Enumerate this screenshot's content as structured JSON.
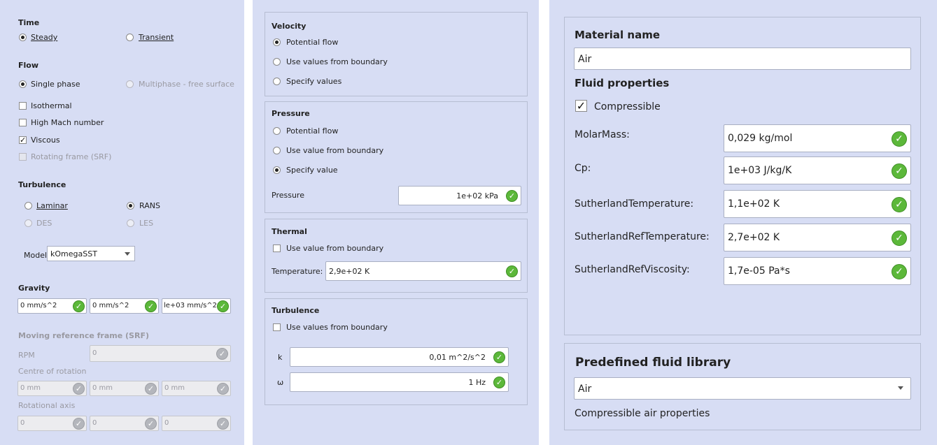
{
  "col1": {
    "time_heading": "Time",
    "time_options": [
      "Steady",
      "Transient"
    ],
    "flow_heading": "Flow",
    "flow_options": [
      "Single phase",
      "Multiphase - free surface"
    ],
    "flow_checks": [
      "Isothermal",
      "High Mach number",
      "Viscous",
      "Rotating frame (SRF)"
    ],
    "turbulence_heading": "Turbulence",
    "turb_options": [
      "Laminar",
      "RANS",
      "DES",
      "LES"
    ],
    "model_label": "Model",
    "model_value": "kOmegaSST",
    "gravity_heading": "Gravity",
    "gravity_values": [
      "0 mm/s^2",
      "0 mm/s^2",
      "le+03 mm/s^2"
    ],
    "srf_heading": "Moving reference frame (SRF)",
    "rpm_label": "RPM",
    "rpm_value": "0",
    "centre_label": "Centre of rotation",
    "centre_values": [
      "0 mm",
      "0 mm",
      "0 mm"
    ],
    "axis_label": "Rotational axis",
    "axis_values": [
      "0",
      "0",
      "0"
    ]
  },
  "col2": {
    "velocity_heading": "Velocity",
    "velocity_options": [
      "Potential flow",
      "Use values from boundary",
      "Specify values"
    ],
    "pressure_heading": "Pressure",
    "pressure_options": [
      "Potential flow",
      "Use value from boundary",
      "Specify value"
    ],
    "pressure_label": "Pressure",
    "pressure_value": "1e+02 kPa",
    "thermal_heading": "Thermal",
    "thermal_check": "Use value from boundary",
    "temperature_label": "Temperature:",
    "temperature_value": "2,9e+02 K",
    "turbulence_heading": "Turbulence",
    "turbulence_check": "Use values from boundary",
    "k_label": "k",
    "k_value": "0,01 m^2/s^2",
    "omega_label": "ω",
    "omega_value": "1 Hz"
  },
  "col3": {
    "material_heading": "Material name",
    "material_value": "Air",
    "fluid_heading": "Fluid properties",
    "compressible_label": "Compressible",
    "props": [
      {
        "label": "MolarMass:",
        "value": "0,029 kg/mol"
      },
      {
        "label": "Cp:",
        "value": "1e+03 J/kg/K"
      },
      {
        "label": "SutherlandTemperature:",
        "value": "1,1e+02 K"
      },
      {
        "label": "SutherlandRefTemperature:",
        "value": "2,7e+02 K"
      },
      {
        "label": "SutherlandRefViscosity:",
        "value": "1,7e-05 Pa*s"
      }
    ],
    "library_heading": "Predefined fluid library",
    "library_value": "Air",
    "library_desc": "Compressible air properties"
  },
  "icons": {
    "ok": "check-circle-icon",
    "dropdown": "chevron-down-icon"
  },
  "colors": {
    "panel_bg": "#d7ddf4",
    "ok_green": "#5cb83a"
  }
}
